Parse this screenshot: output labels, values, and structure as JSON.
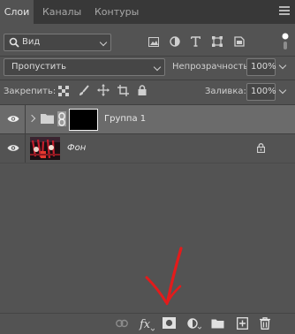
{
  "tabs": [
    {
      "label": "Слои",
      "active": true
    },
    {
      "label": "Каналы",
      "active": false
    },
    {
      "label": "Контуры",
      "active": false
    }
  ],
  "filter": {
    "value": "Вид"
  },
  "blend_mode": {
    "value": "Пропустить"
  },
  "opacity": {
    "label": "Непрозрачность:",
    "value": "100%"
  },
  "lock": {
    "label": "Закрепить:"
  },
  "fill": {
    "label": "Заливка:",
    "value": "100%"
  },
  "layers": [
    {
      "name": "Группа 1",
      "type": "group",
      "selected": true,
      "visible": true
    },
    {
      "name": "Фон",
      "type": "background",
      "selected": false,
      "visible": true,
      "locked": true
    }
  ],
  "colors": {
    "panel": "#535353",
    "tabbar": "#383838",
    "selected_row": "#6b6b6b",
    "annotation_arrow": "#e31b1b"
  },
  "icons": [
    "search-icon",
    "image-filter-icon",
    "adjustment-filter-icon",
    "type-filter-icon",
    "shape-filter-icon",
    "smart-object-filter-icon",
    "filter-toggle-icon",
    "lock-transparent-icon",
    "lock-paint-icon",
    "lock-position-icon",
    "lock-artboard-icon",
    "lock-all-icon",
    "eye-icon",
    "folder-icon",
    "chain-link-icon",
    "padlock-icon",
    "link-layers-icon",
    "fx-icon",
    "layer-mask-icon",
    "adjustment-layer-icon",
    "new-group-icon",
    "new-layer-icon",
    "trash-icon",
    "red-arrow-annotation"
  ]
}
